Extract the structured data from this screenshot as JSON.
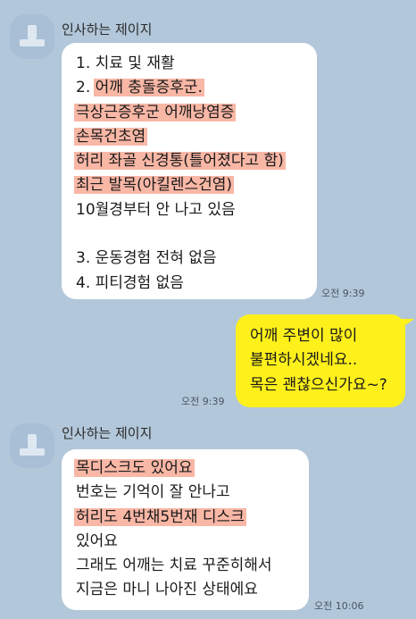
{
  "chat": {
    "group1": {
      "sender": "인사하는 제이지",
      "time": "오전 9:39",
      "lines": [
        "1. 치료 및 재활",
        "2. ",
        "어깨 충돌증후군.",
        "극상근증후군 어깨낭염증",
        "손목건초염",
        "허리 좌골 신경통(틀어졌다고 함)",
        "최근 발목(아킬렌스건염)",
        "10월경부터 안 나고 있음",
        "3. 운동경험 전혀 없음",
        "4. 피티경험 없음"
      ]
    },
    "reply": {
      "time": "오전 9:39",
      "lines": [
        "어깨 주변이 많이",
        "불편하시겠네요..",
        "목은 괜찮으신가요~?"
      ]
    },
    "group2": {
      "sender": "인사하는 제이지",
      "time": "오전 10:06",
      "lines": [
        "목디스크도 있어요",
        "번호는 기억이 잘 안나고",
        "허리도 4번채5번재 디스크",
        "있어요",
        "그래도 어깨는  치료 꾸준히해서",
        "지금은  마니 나아진 상태에요"
      ]
    },
    "colors": {
      "background": "#b2c7da",
      "incoming_bubble": "#ffffff",
      "outgoing_bubble": "#fef01b",
      "highlight": "#f9b7a6"
    }
  }
}
